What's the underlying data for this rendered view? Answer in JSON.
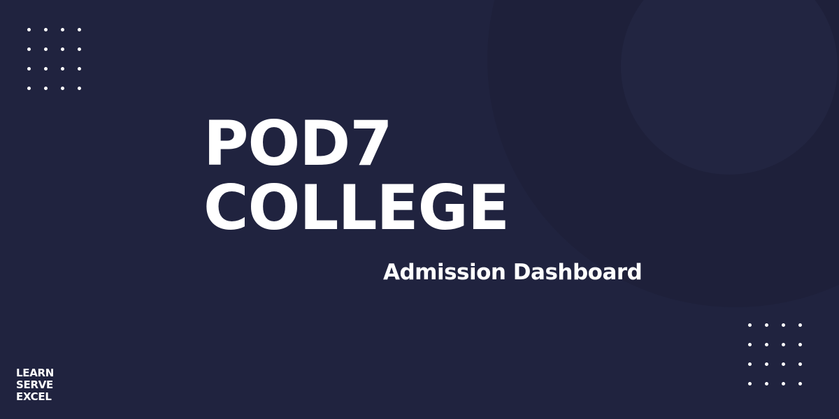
{
  "hero": {
    "title_line1": "POD7",
    "title_line2": "COLLEGE",
    "subtitle": "Admission Dashboard"
  },
  "brand": {
    "line1": "LEARN",
    "line2": "SERVE",
    "line3": "EXCEL"
  },
  "colors": {
    "background": "#20233F",
    "circle_outer": "#1E203A",
    "circle_inner": "#222541",
    "text": "#FFFFFF"
  }
}
